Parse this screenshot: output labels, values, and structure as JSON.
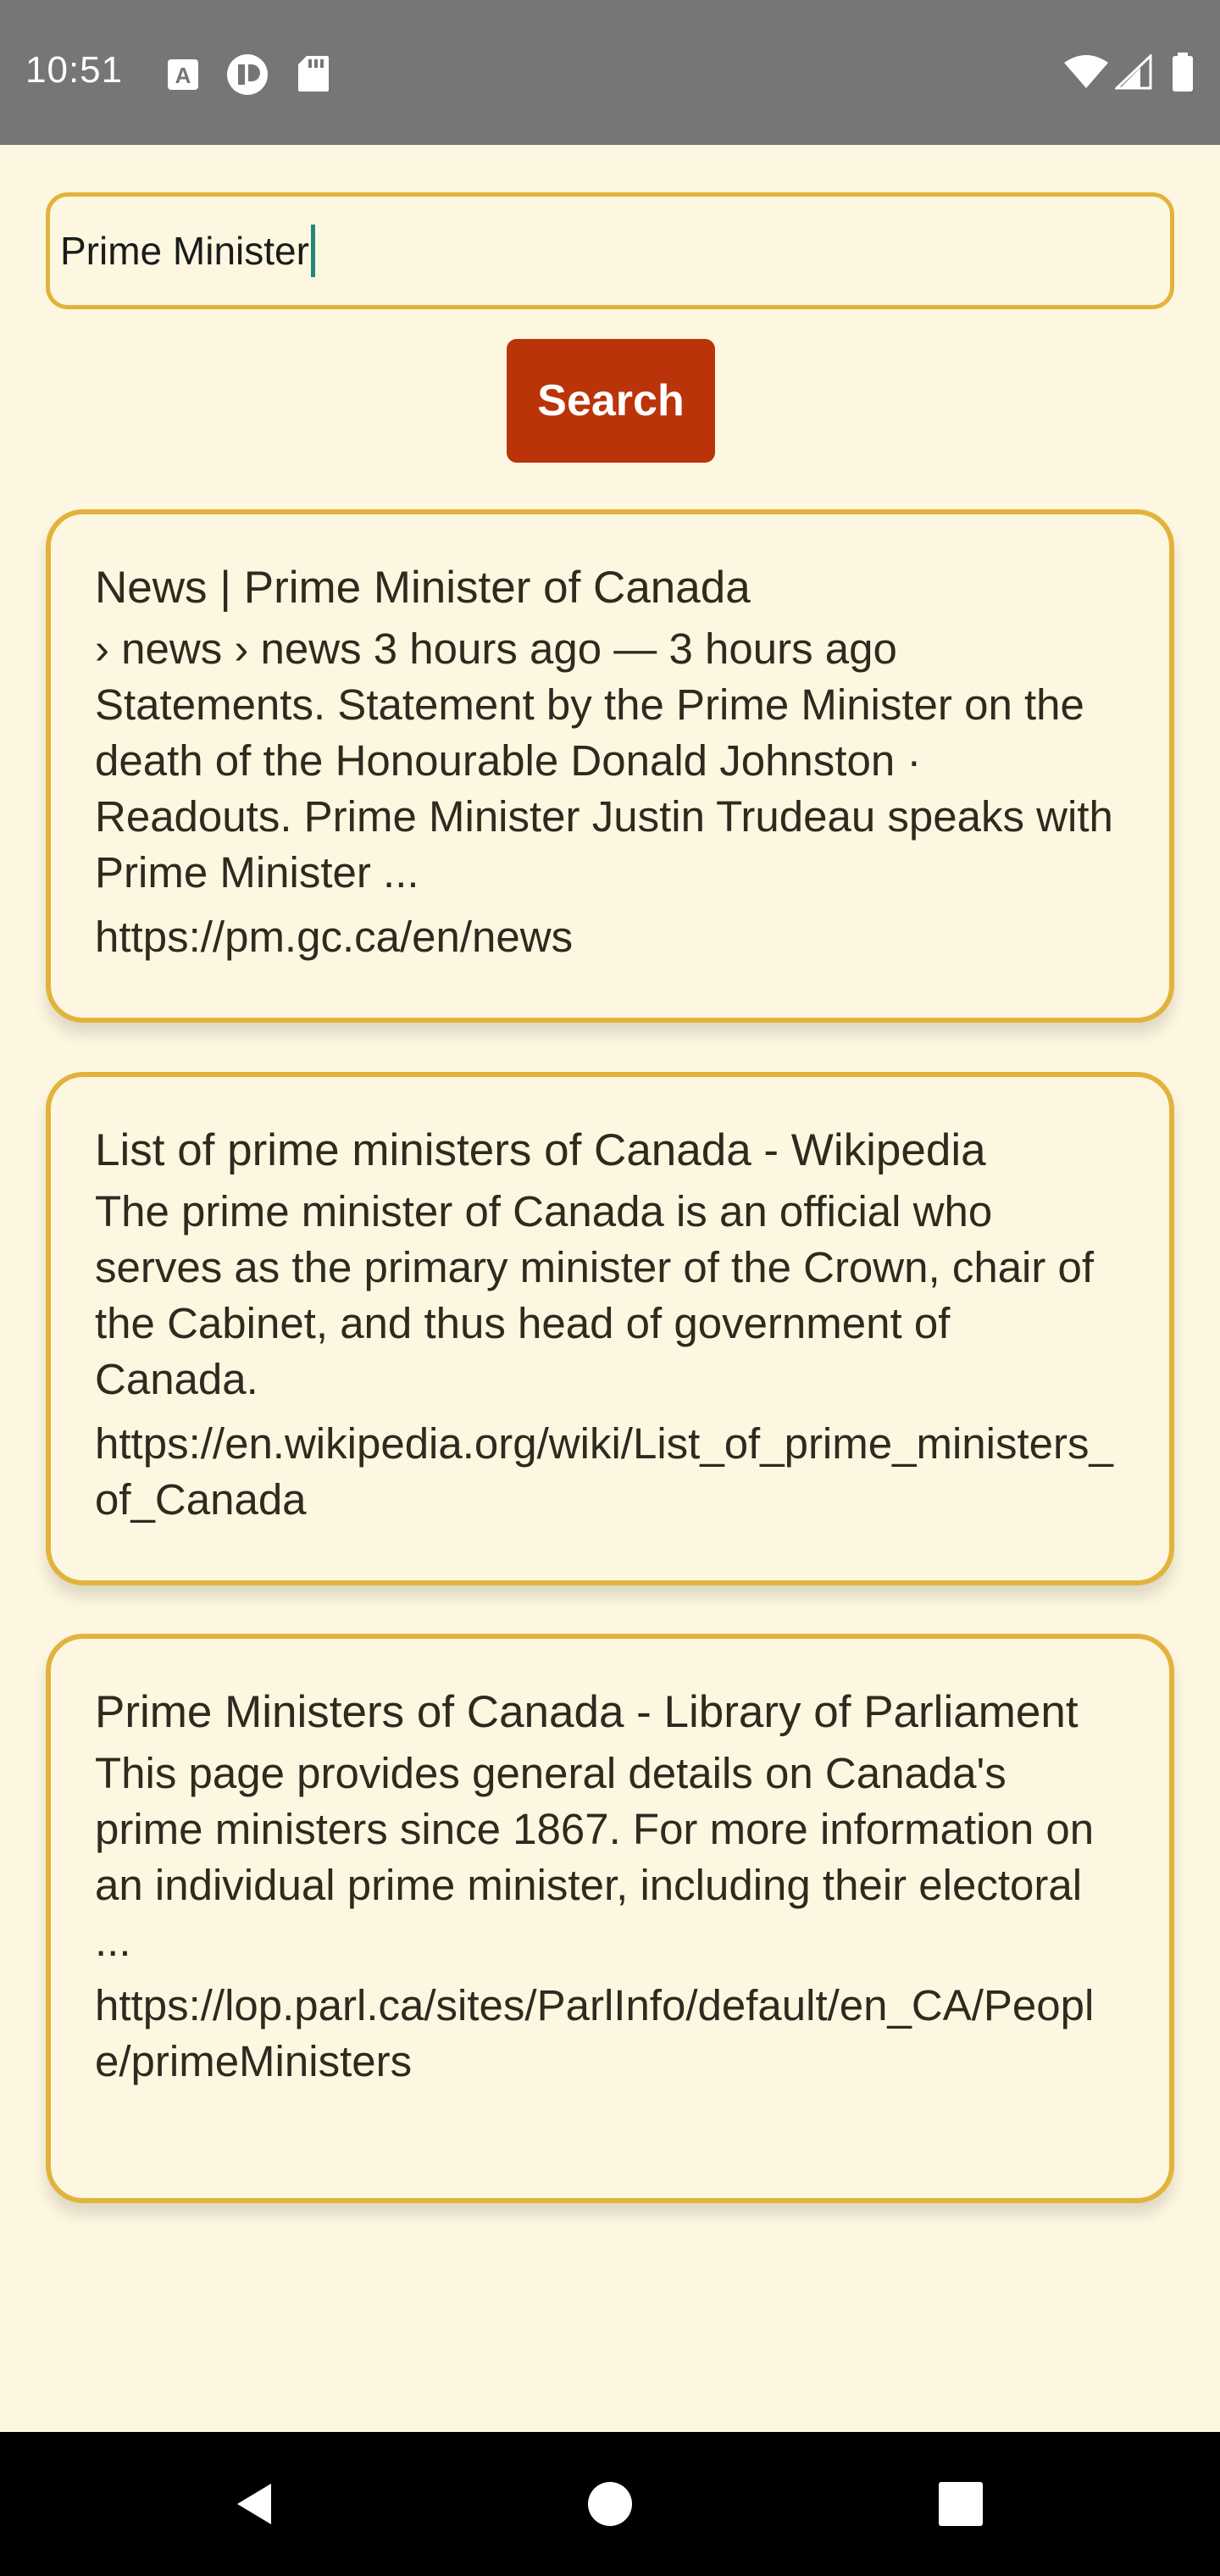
{
  "status_bar": {
    "time": "10:51",
    "left_icons": [
      "a-notification-icon",
      "p-notification-icon",
      "sd-card-icon"
    ],
    "right_icons": [
      "wifi-icon",
      "cell-signal-icon",
      "battery-icon"
    ]
  },
  "search": {
    "value": "Prime Minister",
    "button_label": "Search"
  },
  "results": [
    {
      "title": "News | Prime Minister of Canada",
      "snippet": " › news  › news 3 hours ago —  3 hours ago Statements. Statement by the Prime Minister on the death of the Honourable Donald Johnston · Readouts. Prime Minister Justin Trudeau speaks with Prime Minister ...",
      "url": "https://pm.gc.ca/en/news"
    },
    {
      "title": "List of prime ministers of Canada - Wikipedia",
      "snippet": "The prime minister of Canada is an official who serves as the primary minister of the Crown, chair of the Cabinet, and thus head of government of Canada.",
      "url": "https://en.wikipedia.org/wiki/List_of_prime_ministers_of_Canada"
    },
    {
      "title": "Prime Ministers of Canada - Library of Parliament",
      "snippet": "This page provides general details on Canada's prime ministers since 1867. For more information on an individual prime minister, including their electoral ...",
      "url": "https://lop.parl.ca/sites/ParlInfo/default/en_CA/People/primeMinisters"
    }
  ],
  "nav_bar": {
    "icons": [
      "back-icon",
      "home-icon",
      "recents-icon"
    ]
  },
  "colors": {
    "background": "#fdf7e1",
    "status_bar": "#767676",
    "border_accent": "#e2b33c",
    "button": "#bb3309",
    "caret": "#1f8a74",
    "nav_bar": "#000000"
  }
}
